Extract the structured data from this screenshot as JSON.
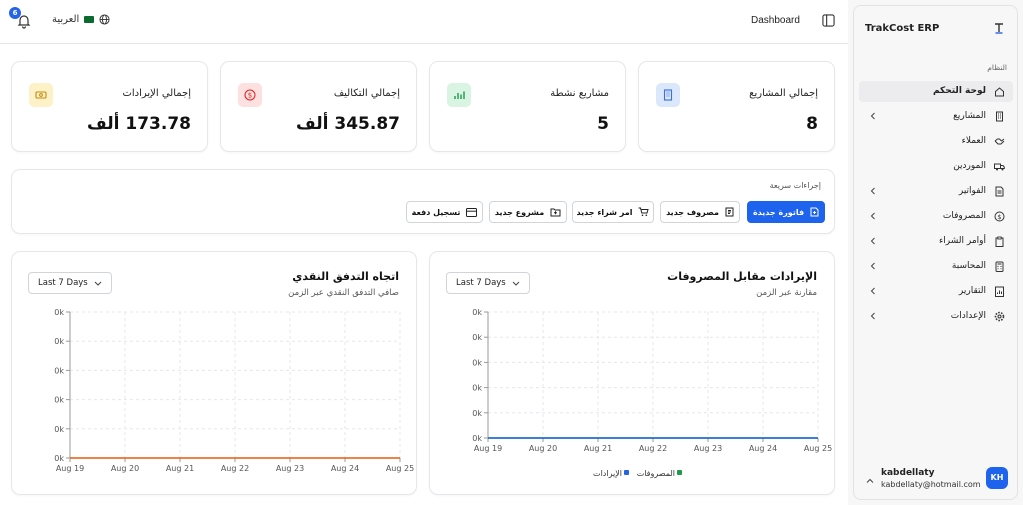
{
  "header": {
    "notification_count": "6",
    "language": "العربية",
    "page_title": "Dashboard"
  },
  "stats": [
    {
      "title": "إجمالي المشاريع",
      "value": "8",
      "icon": "building-icon",
      "color": "#3b6fd6",
      "bg": "#dbe7fb"
    },
    {
      "title": "مشاريع نشطة",
      "value": "5",
      "icon": "bar-chart-icon",
      "color": "#1f9a4d",
      "bg": "#d9f4e2"
    },
    {
      "title": "إجمالي التكاليف",
      "value": "345.87 ألف",
      "icon": "dollar-icon",
      "color": "#dc2626",
      "bg": "#fde1e1"
    },
    {
      "title": "إجمالي الإيرادات",
      "value": "173.78 ألف",
      "icon": "banknote-icon",
      "color": "#c58a08",
      "bg": "#fdf1c7"
    }
  ],
  "quick_actions": {
    "title": "إجراءات سريعة",
    "buttons": [
      {
        "label": "فاتورة جديدة",
        "icon": "file-plus-icon"
      },
      {
        "label": "مصروف جديد",
        "icon": "receipt-icon"
      },
      {
        "label": "امر شراء جديد",
        "icon": "cart-icon"
      },
      {
        "label": "مشروع جديد",
        "icon": "folder-plus-icon"
      },
      {
        "label": "تسجيل دفعة",
        "icon": "credit-card-icon"
      }
    ]
  },
  "revenue_chart": {
    "title": "الإيرادات مقابل المصروفات",
    "subtitle": "مقارنة عبر الزمن",
    "range": "Last 7 Days"
  },
  "cashflow_chart": {
    "title": "اتجاه التدفق النقدي",
    "subtitle": "صافي التدفق النقدي عبر الزمن",
    "range": "Last 7 Days"
  },
  "chart_data": [
    {
      "type": "line",
      "x": [
        "Aug 19",
        "Aug 20",
        "Aug 21",
        "Aug 22",
        "Aug 23",
        "Aug 24",
        "Aug 25"
      ],
      "y_ticks": [
        "0k",
        "0k",
        "0k",
        "0k",
        "0k",
        "0k"
      ],
      "series": [
        {
          "name": "المصروفات",
          "values": [
            0,
            0,
            0,
            0,
            0,
            0,
            0
          ],
          "color": "#1f9a4d"
        },
        {
          "name": "الإيرادات",
          "values": [
            0,
            0,
            0,
            0,
            0,
            0,
            0
          ],
          "color": "#2563eb"
        }
      ],
      "legend_position": "bottom",
      "grid": true
    },
    {
      "type": "line",
      "x": [
        "Aug 19",
        "Aug 20",
        "Aug 21",
        "Aug 22",
        "Aug 23",
        "Aug 24",
        "Aug 25"
      ],
      "y_ticks": [
        "0k",
        "0k",
        "0k",
        "0k",
        "0k",
        "0k"
      ],
      "series": [
        {
          "values": [
            0,
            0,
            0,
            0,
            0,
            0,
            0
          ],
          "color": "#ea580c"
        }
      ],
      "grid": true
    }
  ],
  "sidebar": {
    "brand": "TrakCost ERP",
    "section": "النظام",
    "items": [
      {
        "label": "لوحة التحكم",
        "icon": "home-icon",
        "chevron": false,
        "active": true
      },
      {
        "label": "المشاريع",
        "icon": "building-icon",
        "chevron": true,
        "active": false
      },
      {
        "label": "العملاء",
        "icon": "handshake-icon",
        "chevron": false,
        "active": false
      },
      {
        "label": "الموردين",
        "icon": "truck-icon",
        "chevron": false,
        "active": false
      },
      {
        "label": "الفواتير",
        "icon": "file-text-icon",
        "chevron": true,
        "active": false
      },
      {
        "label": "المصروفات",
        "icon": "dollar-circle-icon",
        "chevron": true,
        "active": false
      },
      {
        "label": "أوامر الشراء",
        "icon": "clipboard-icon",
        "chevron": true,
        "active": false
      },
      {
        "label": "المحاسبة",
        "icon": "calculator-icon",
        "chevron": true,
        "active": false
      },
      {
        "label": "التقارير",
        "icon": "report-icon",
        "chevron": true,
        "active": false
      },
      {
        "label": "الإعدادات",
        "icon": "settings-icon",
        "chevron": true,
        "active": false
      }
    ],
    "user": {
      "name": "kabdellaty",
      "email": "kabdellaty@hotmail.com",
      "initials": "KH"
    }
  }
}
